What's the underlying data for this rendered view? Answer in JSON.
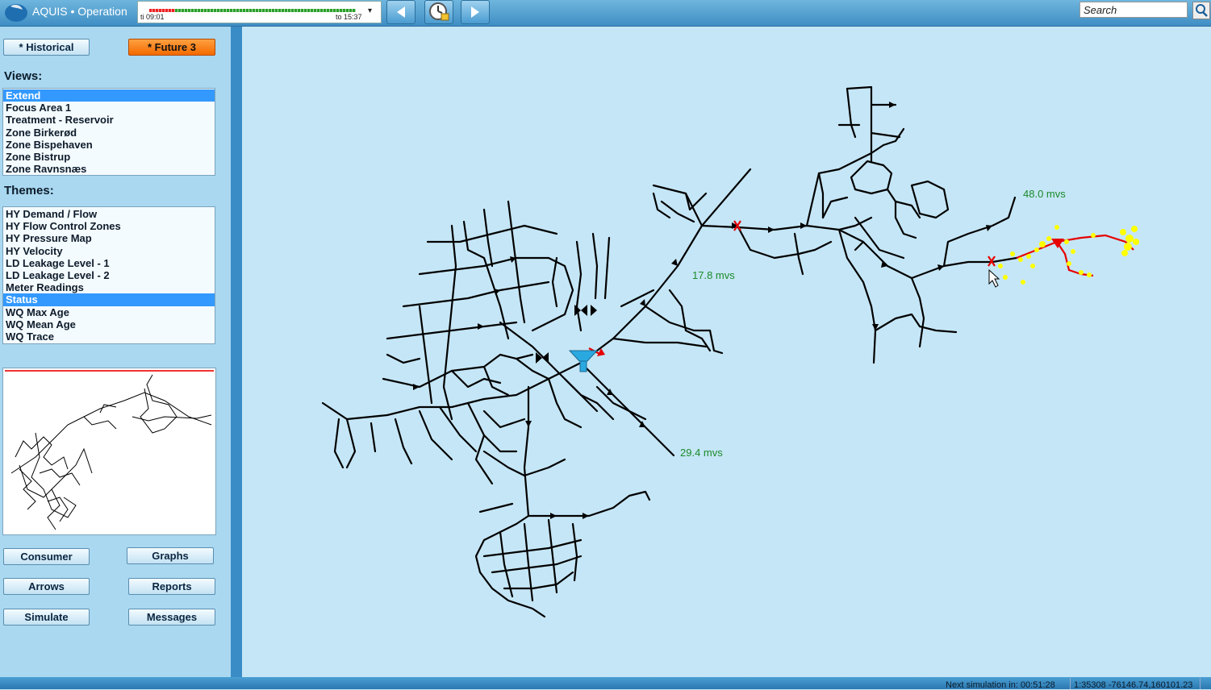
{
  "app": {
    "title": "AQUIS • Operation"
  },
  "timeline": {
    "from_label": "ti 09:01",
    "to_label": "to 15:37",
    "dropdown_glyph": "▾"
  },
  "toolbar": {
    "prev_icon": "triangle-left-icon",
    "clock_icon": "clock-lock-icon",
    "next_icon": "triangle-right-icon"
  },
  "search": {
    "placeholder": "Search",
    "icon": "magnifier-icon"
  },
  "modes": {
    "historical": "* Historical",
    "future": "* Future 3"
  },
  "views": {
    "heading": "Views:",
    "items": [
      "Extend",
      "Focus Area 1",
      "Treatment - Reservoir",
      "Zone Birkerød",
      "Zone Bispehaven",
      "Zone Bistrup",
      "Zone Ravnsnæs"
    ],
    "selected": "Extend"
  },
  "themes": {
    "heading": "Themes:",
    "items": [
      "HY Demand / Flow",
      "HY Flow Control Zones",
      "HY Pressure Map",
      "HY Velocity",
      "LD Leakage Level - 1",
      "LD Leakage Level - 2",
      "Meter Readings",
      "Status",
      "WQ Max Age",
      "WQ Mean Age",
      "WQ Trace"
    ],
    "selected": "Status"
  },
  "buttons": {
    "consumer": "Consumer",
    "graphs": "Graphs",
    "arrows": "Arrows",
    "reports": "Reports",
    "simulate": "Simulate",
    "messages": "Messages"
  },
  "map": {
    "labels": {
      "east": "48.0 mvs",
      "north": "17.8 mvs",
      "south": "29.4 mvs"
    }
  },
  "status_bar": {
    "next_simulation": "Next simulation in: 00:51:28",
    "scale_coords": "1:35308 -76146.74,160101.23"
  },
  "colors": {
    "selection": "#3399ff",
    "future_button": "#f46a00",
    "pipe": "#000000",
    "highlight_pipe": "#e60000",
    "meters": "#ffff00",
    "pressure_label": "#1b8a2a",
    "reservoir": "#2aa8e0"
  }
}
